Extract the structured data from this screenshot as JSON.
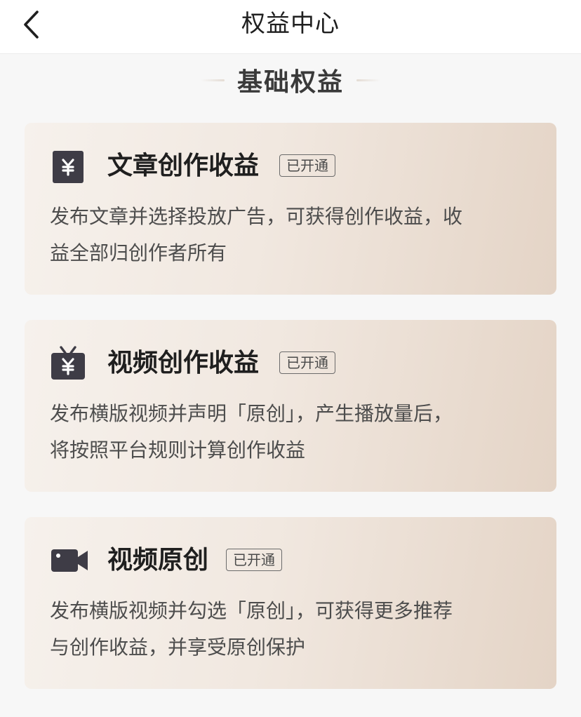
{
  "header": {
    "title": "权益中心"
  },
  "section": {
    "title": "基础权益"
  },
  "cards": [
    {
      "icon": "yuan-icon",
      "title": "文章创作收益",
      "badge": "已开通",
      "desc_lines": [
        "发布文章并选择投放广告，可获得创作收益，收",
        "益全部归创作者所有"
      ]
    },
    {
      "icon": "tv-yuan-icon",
      "title": "视频创作收益",
      "badge": "已开通",
      "desc_lines": [
        "发布横版视频并声明「原创」，产生播放量后，",
        "将按照平台规则计算创作收益"
      ]
    },
    {
      "icon": "video-camera-icon",
      "title": "视频原创",
      "badge": "已开通",
      "desc_lines": [
        "发布横版视频并勾选「原创」，可获得更多推荐",
        "与创作收益，并享受原创保护"
      ]
    }
  ],
  "colors": {
    "icon": "#3e3c46",
    "card_start": "#f6f1ec",
    "card_end": "#e4d4c6",
    "page_bg": "#f7f7f7"
  }
}
